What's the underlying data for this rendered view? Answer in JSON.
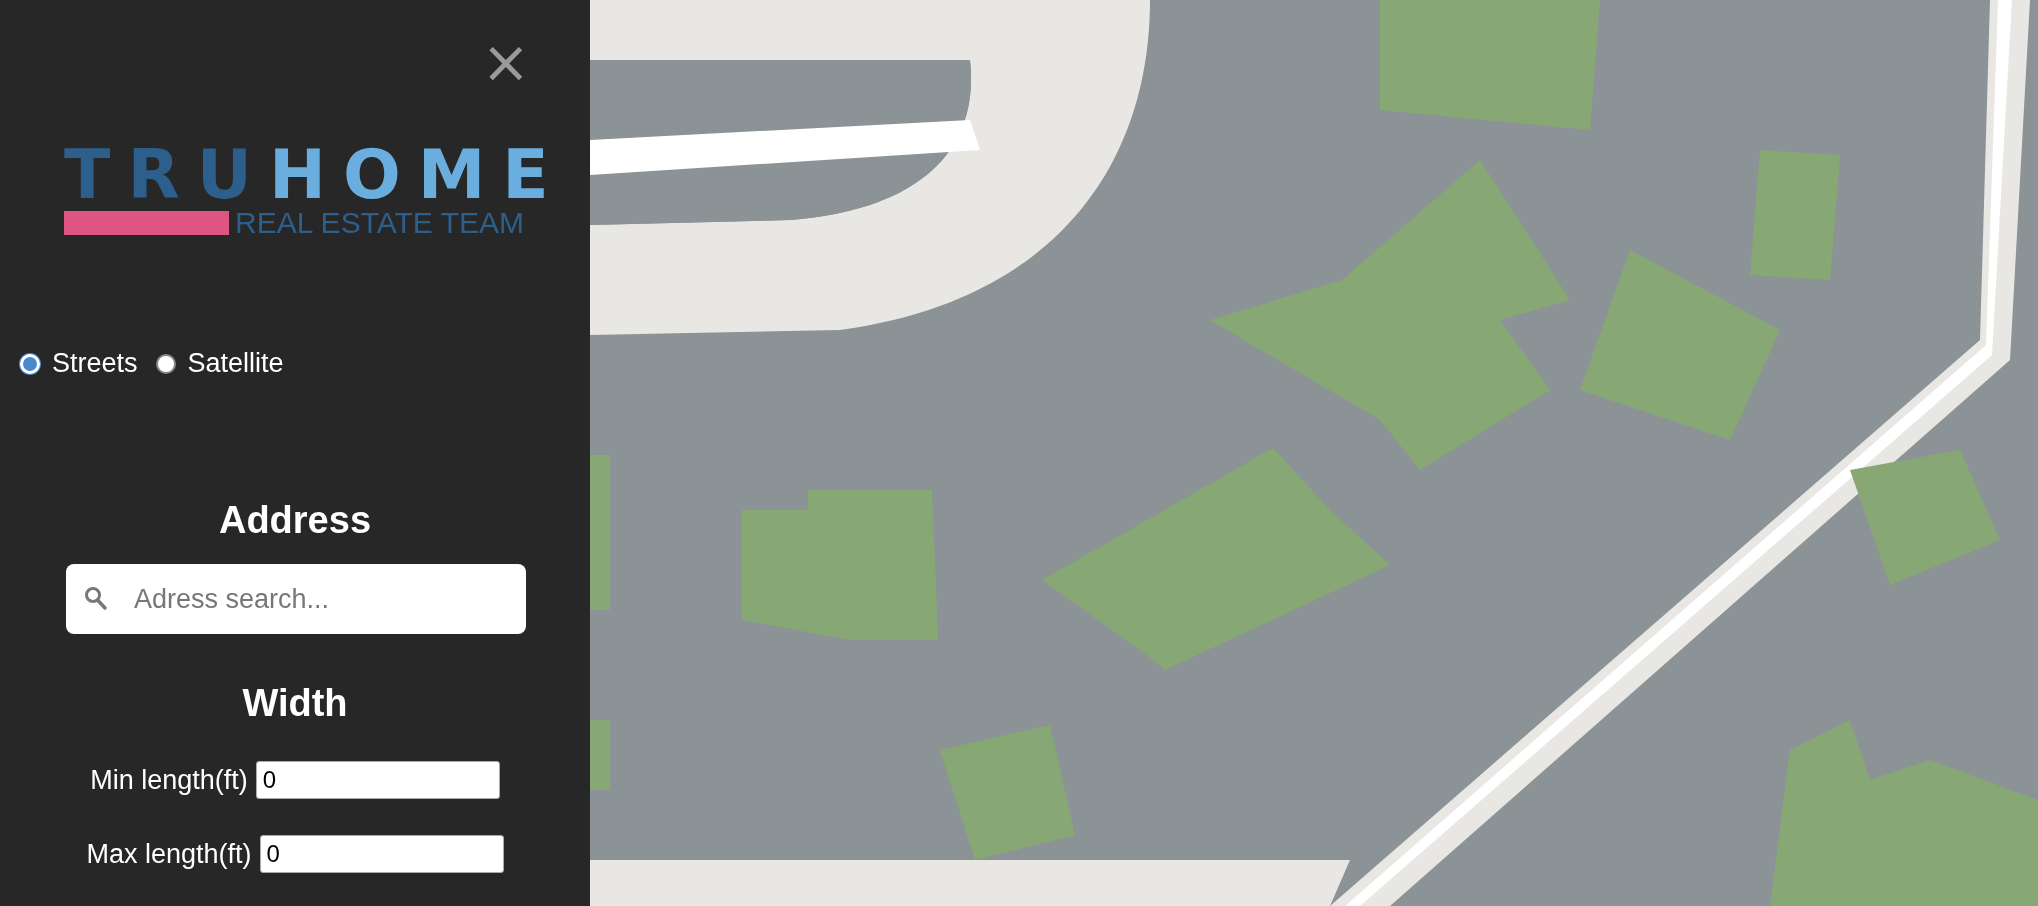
{
  "sidebar": {
    "close": "×",
    "logo": {
      "word_1": "TRU",
      "word_2": "HOME",
      "tagline": "REAL ESTATE TEAM"
    },
    "map_styles": [
      {
        "label": "Streets",
        "selected": true
      },
      {
        "label": "Satellite",
        "selected": false
      }
    ],
    "address": {
      "heading": "Address",
      "placeholder": "Adress search..."
    },
    "width": {
      "heading": "Width",
      "fields": [
        {
          "label": "Min length(ft)",
          "value": "0"
        },
        {
          "label": "Max length(ft)",
          "value": "0"
        }
      ]
    }
  }
}
